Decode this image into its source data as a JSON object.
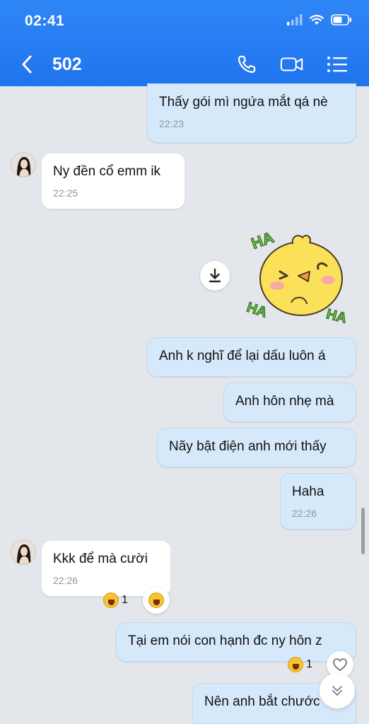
{
  "status": {
    "time": "02:41"
  },
  "nav": {
    "title": "502",
    "back_icon": "chevron-left-icon",
    "call_icon": "phone-icon",
    "video_icon": "video-icon",
    "menu_icon": "list-icon"
  },
  "messages": [
    {
      "side": "out",
      "text": "Thấy gói mì ngứa mắt qá nè",
      "time": "22:23"
    },
    {
      "side": "in",
      "text": "Ny đền cổ emm ik",
      "time": "22:25"
    },
    {
      "side": "out",
      "sticker": "duck-laughing-sticker",
      "sticker_text": [
        "HA",
        "HA",
        "HA"
      ]
    },
    {
      "side": "out",
      "text": "Anh k nghĩ để lại dấu luôn á"
    },
    {
      "side": "out",
      "text": "Anh hôn nhẹ mà"
    },
    {
      "side": "out",
      "text": "Nãy bật điện anh mới thấy"
    },
    {
      "side": "out",
      "text": "Haha",
      "time": "22:26"
    },
    {
      "side": "in",
      "text": "Kkk để mà cười",
      "time": "22:26",
      "reaction_count": "1"
    },
    {
      "side": "out",
      "text": "Tại em nói con hạnh đc ny hôn z",
      "reaction_count": "1"
    },
    {
      "side": "out",
      "text": "Nên anh bắt chước"
    }
  ],
  "colors": {
    "header": "#2f86f6",
    "bubble_out": "#d6e9fb",
    "bubble_in": "#ffffff",
    "background": "#e3e7ec"
  }
}
